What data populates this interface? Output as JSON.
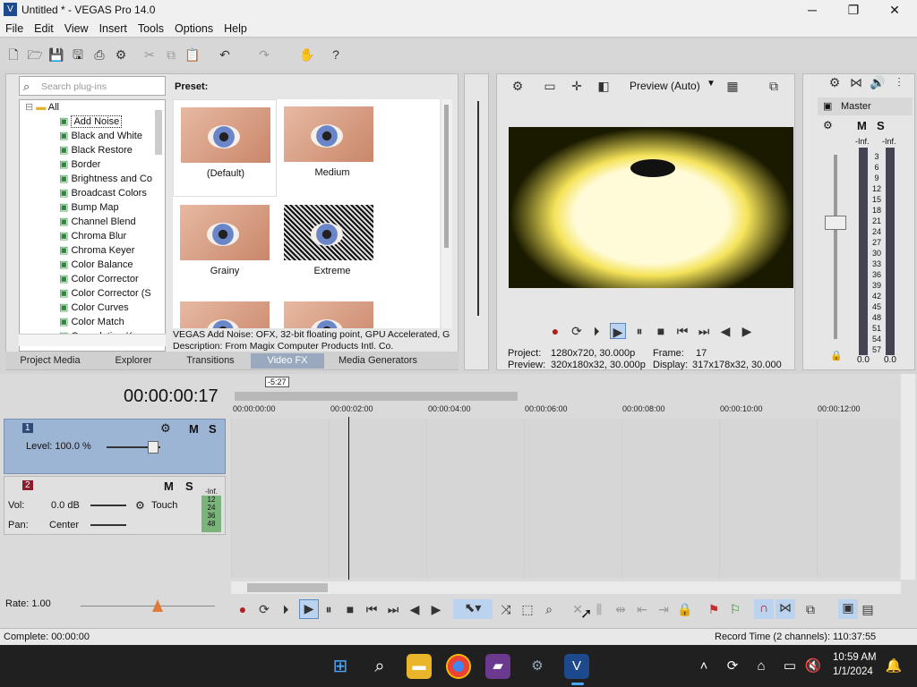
{
  "window": {
    "title": "Untitled * - VEGAS Pro 14.0",
    "min": "─",
    "max": "❐",
    "close": "✕"
  },
  "menu": [
    "File",
    "Edit",
    "View",
    "Insert",
    "Tools",
    "Options",
    "Help"
  ],
  "plugins": {
    "search_placeholder": "Search plug-ins",
    "root": "All",
    "items": [
      "Add Noise",
      "Black and White",
      "Black Restore",
      "Border",
      "Brightness and Co",
      "Broadcast Colors",
      "Bump Map",
      "Channel Blend",
      "Chroma Blur",
      "Chroma Keyer",
      "Color Balance",
      "Color Corrector",
      "Color Corrector (S",
      "Color Curves",
      "Color Match",
      "Convolution Kerne"
    ],
    "preset_label": "Preset:",
    "presets": [
      "(Default)",
      "Medium",
      "Grainy",
      "Extreme"
    ],
    "desc1": "VEGAS Add Noise: OFX, 32-bit floating point, GPU Accelerated, G",
    "desc2": "Description: From Magix Computer Products Intl. Co."
  },
  "tabs": [
    "Project Media",
    "Explorer",
    "Transitions",
    "Video FX",
    "Media Generators"
  ],
  "preview": {
    "mode": "Preview (Auto)",
    "project_label": "Project:",
    "project_val": "1280x720, 30.000p",
    "preview_label": "Preview:",
    "preview_val": "320x180x32, 30.000p",
    "frame_label": "Frame:",
    "frame_val": "17",
    "display_label": "Display:",
    "display_val": "317x178x32, 30.000"
  },
  "master": {
    "label": "Master",
    "m": "M",
    "s": "S",
    "inf_l": "-Inf.",
    "inf_r": "-Inf.",
    "scale": [
      "3",
      "6",
      "9",
      "12",
      "15",
      "18",
      "21",
      "24",
      "27",
      "30",
      "33",
      "36",
      "39",
      "42",
      "45",
      "48",
      "51",
      "54",
      "57"
    ],
    "val_l": "0.0",
    "val_r": "0.0"
  },
  "timeline": {
    "timecode": "00:00:00:17",
    "loop_label": "-5:27",
    "ruler": [
      "00:00:00:00",
      "00:00:02:00",
      "00:00:04:00",
      "00:00:06:00",
      "00:00:08:00",
      "00:00:10:00",
      "00:00:12:00"
    ],
    "track1": {
      "num": "1",
      "level": "Level: 100.0 %",
      "m": "M",
      "s": "S"
    },
    "track2": {
      "num": "2",
      "vol_label": "Vol:",
      "vol": "0.0 dB",
      "pan_label": "Pan:",
      "pan": "Center",
      "touch": "Touch",
      "m": "M",
      "s": "S",
      "inf": "-Inf.",
      "scale": [
        "12",
        "24",
        "36",
        "48"
      ]
    }
  },
  "rate": "Rate: 1.00",
  "status": {
    "left": "Complete: 00:00:00",
    "right": "Record Time (2 channels): 110:37:55"
  },
  "clock": {
    "time": "10:59 AM",
    "date": "1/1/2024"
  },
  "colors": {
    "track1": "#9db5d4",
    "taskbar": "#202020"
  }
}
